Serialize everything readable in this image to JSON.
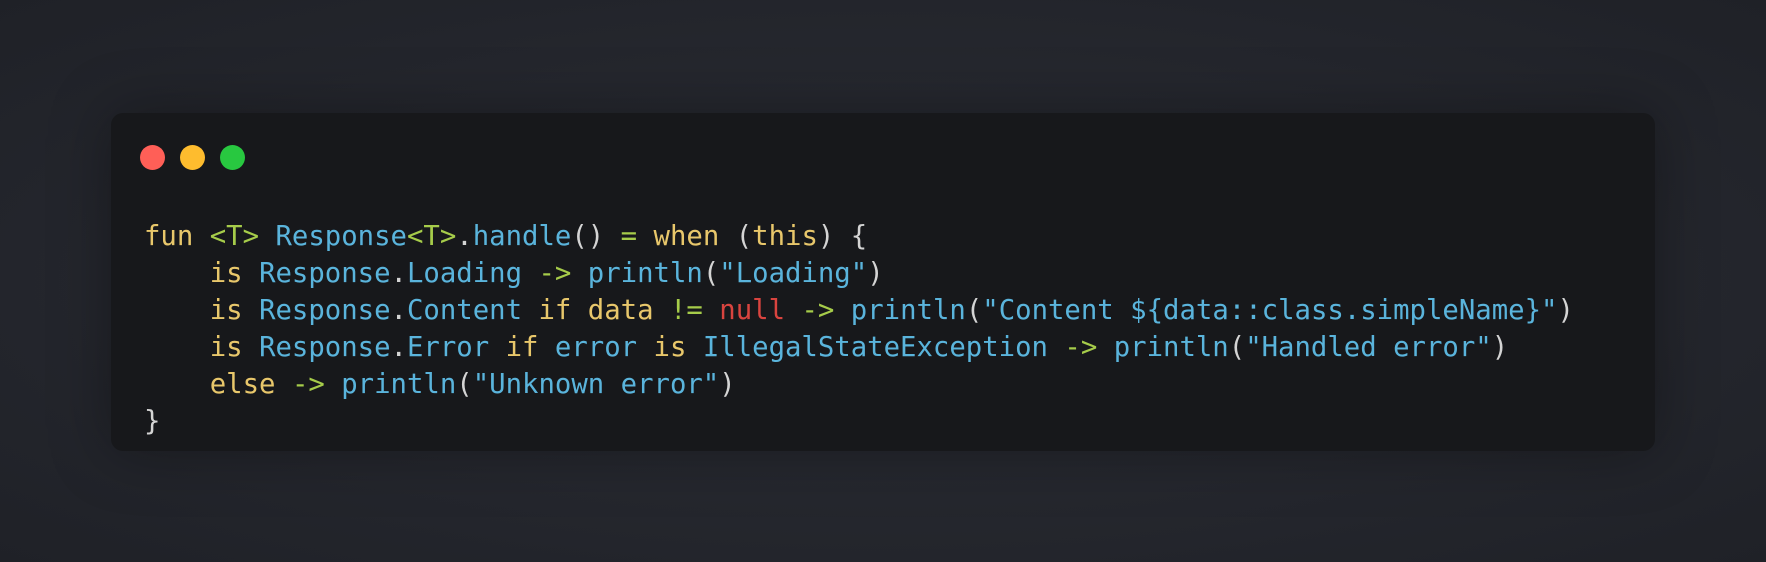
{
  "window": {
    "controls": [
      {
        "name": "close",
        "color": "#ff5f57"
      },
      {
        "name": "minimize",
        "color": "#febc2e"
      },
      {
        "name": "maximize",
        "color": "#28c840"
      }
    ]
  },
  "colors": {
    "keyword": "#e8c76b",
    "type": "#5ab4dc",
    "operator": "#a6cc4a",
    "string": "#5ab4dc",
    "null": "#d9443f",
    "plain": "#d4d4d4",
    "background": "#17181b"
  },
  "code": {
    "language": "kotlin",
    "lines": [
      [
        {
          "t": "fun",
          "k": "kw"
        },
        {
          "t": " ",
          "k": "pl"
        },
        {
          "t": "<T>",
          "k": "op"
        },
        {
          "t": " ",
          "k": "pl"
        },
        {
          "t": "Response",
          "k": "ty"
        },
        {
          "t": "<T>",
          "k": "op"
        },
        {
          "t": ".",
          "k": "pl"
        },
        {
          "t": "handle",
          "k": "fn"
        },
        {
          "t": "() ",
          "k": "pl"
        },
        {
          "t": "=",
          "k": "op"
        },
        {
          "t": " ",
          "k": "pl"
        },
        {
          "t": "when",
          "k": "kw"
        },
        {
          "t": " (",
          "k": "pl"
        },
        {
          "t": "this",
          "k": "kw"
        },
        {
          "t": ") {",
          "k": "pl"
        }
      ],
      [
        {
          "t": "    ",
          "k": "pl"
        },
        {
          "t": "is",
          "k": "kw"
        },
        {
          "t": " ",
          "k": "pl"
        },
        {
          "t": "Response",
          "k": "ty"
        },
        {
          "t": ".",
          "k": "pl"
        },
        {
          "t": "Loading",
          "k": "ty"
        },
        {
          "t": " ",
          "k": "pl"
        },
        {
          "t": "->",
          "k": "op"
        },
        {
          "t": " ",
          "k": "pl"
        },
        {
          "t": "println",
          "k": "fn"
        },
        {
          "t": "(",
          "k": "pl"
        },
        {
          "t": "\"Loading\"",
          "k": "str"
        },
        {
          "t": ")",
          "k": "pl"
        }
      ],
      [
        {
          "t": "    ",
          "k": "pl"
        },
        {
          "t": "is",
          "k": "kw"
        },
        {
          "t": " ",
          "k": "pl"
        },
        {
          "t": "Response",
          "k": "ty"
        },
        {
          "t": ".",
          "k": "pl"
        },
        {
          "t": "Content",
          "k": "ty"
        },
        {
          "t": " ",
          "k": "pl"
        },
        {
          "t": "if",
          "k": "kw"
        },
        {
          "t": " ",
          "k": "pl"
        },
        {
          "t": "data",
          "k": "kw"
        },
        {
          "t": " ",
          "k": "pl"
        },
        {
          "t": "!=",
          "k": "op"
        },
        {
          "t": " ",
          "k": "pl"
        },
        {
          "t": "null",
          "k": "nul"
        },
        {
          "t": " ",
          "k": "pl"
        },
        {
          "t": "->",
          "k": "op"
        },
        {
          "t": " ",
          "k": "pl"
        },
        {
          "t": "println",
          "k": "fn"
        },
        {
          "t": "(",
          "k": "pl"
        },
        {
          "t": "\"Content ${data::class.simpleName}\"",
          "k": "str"
        },
        {
          "t": ")",
          "k": "pl"
        }
      ],
      [
        {
          "t": "    ",
          "k": "pl"
        },
        {
          "t": "is",
          "k": "kw"
        },
        {
          "t": " ",
          "k": "pl"
        },
        {
          "t": "Response",
          "k": "ty"
        },
        {
          "t": ".",
          "k": "pl"
        },
        {
          "t": "Error",
          "k": "ty"
        },
        {
          "t": " ",
          "k": "pl"
        },
        {
          "t": "if",
          "k": "kw"
        },
        {
          "t": " ",
          "k": "pl"
        },
        {
          "t": "error",
          "k": "ty"
        },
        {
          "t": " ",
          "k": "pl"
        },
        {
          "t": "is",
          "k": "kw"
        },
        {
          "t": " ",
          "k": "pl"
        },
        {
          "t": "IllegalStateException",
          "k": "ty"
        },
        {
          "t": " ",
          "k": "pl"
        },
        {
          "t": "->",
          "k": "op"
        },
        {
          "t": " ",
          "k": "pl"
        },
        {
          "t": "println",
          "k": "fn"
        },
        {
          "t": "(",
          "k": "pl"
        },
        {
          "t": "\"Handled error\"",
          "k": "str"
        },
        {
          "t": ")",
          "k": "pl"
        }
      ],
      [
        {
          "t": "    ",
          "k": "pl"
        },
        {
          "t": "else",
          "k": "kw"
        },
        {
          "t": " ",
          "k": "pl"
        },
        {
          "t": "->",
          "k": "op"
        },
        {
          "t": " ",
          "k": "pl"
        },
        {
          "t": "println",
          "k": "fn"
        },
        {
          "t": "(",
          "k": "pl"
        },
        {
          "t": "\"Unknown error\"",
          "k": "str"
        },
        {
          "t": ")",
          "k": "pl"
        }
      ],
      [
        {
          "t": "}",
          "k": "pl"
        }
      ]
    ]
  }
}
